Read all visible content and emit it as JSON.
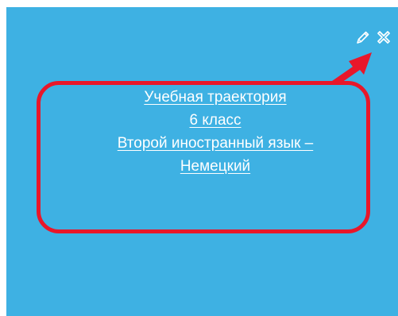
{
  "tile": {
    "background": "#3eb1e3",
    "title_lines": [
      "Учебная траектория",
      "6 класс",
      "Второй иностранный язык –",
      "Немецкий"
    ],
    "actions": [
      {
        "icon": "pencil-icon",
        "label": "edit"
      },
      {
        "icon": "close-x-icon",
        "label": "delete"
      }
    ]
  },
  "annotation": {
    "highlight_color": "#e8172a",
    "arrow_color": "#e8172a"
  }
}
